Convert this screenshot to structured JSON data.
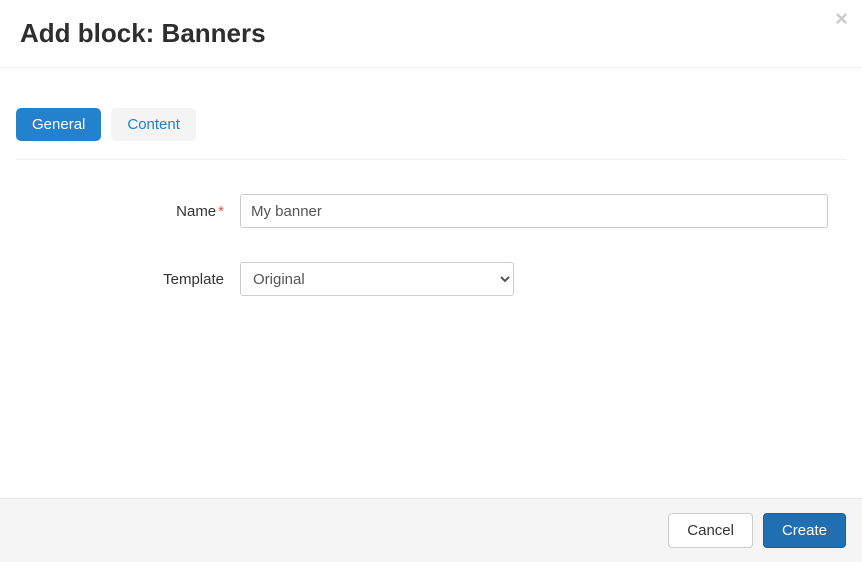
{
  "header": {
    "title": "Add block: Banners"
  },
  "tabs": {
    "general": "General",
    "content": "Content"
  },
  "form": {
    "name_label": "Name",
    "name_value": "My banner",
    "template_label": "Template",
    "template_value": "Original"
  },
  "footer": {
    "cancel": "Cancel",
    "create": "Create"
  }
}
